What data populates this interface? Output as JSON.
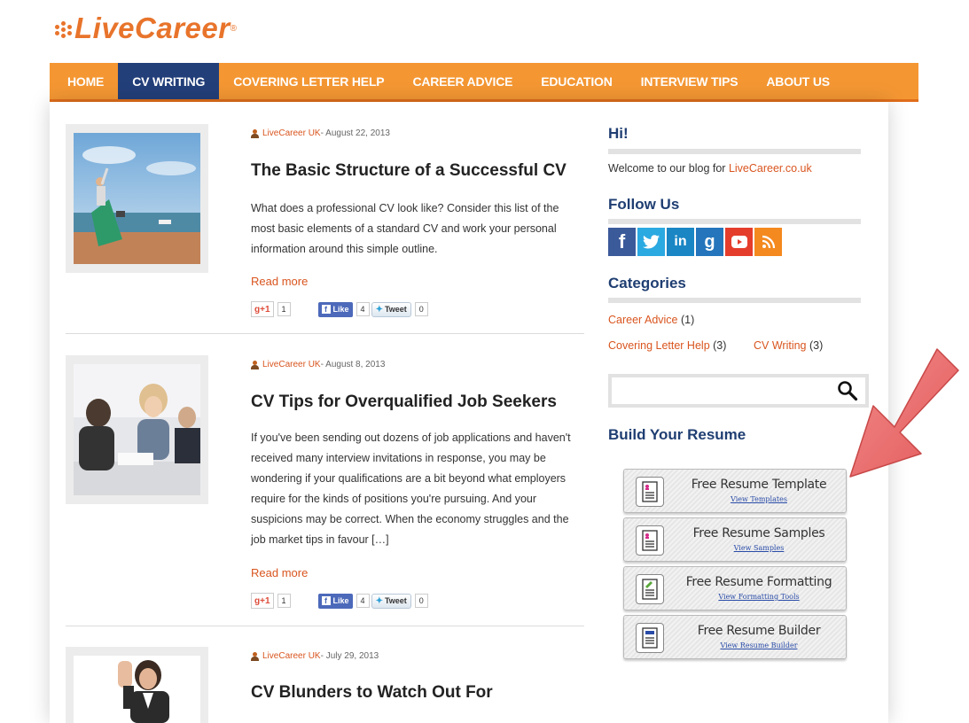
{
  "logo": {
    "text": "LiveCareer",
    "registered": "®"
  },
  "nav": {
    "items": [
      {
        "label": "HOME",
        "active": false
      },
      {
        "label": "CV WRITING",
        "active": true
      },
      {
        "label": "COVERING LETTER HELP",
        "active": false
      },
      {
        "label": "CAREER ADVICE",
        "active": false
      },
      {
        "label": "EDUCATION",
        "active": false
      },
      {
        "label": "INTERVIEW TIPS",
        "active": false
      },
      {
        "label": "ABOUT US",
        "active": false
      }
    ]
  },
  "posts": [
    {
      "author": "LiveCareer UK",
      "date": " - August 22, 2013",
      "title": "The Basic Structure of a Successful CV",
      "excerpt": "What does a professional CV look like? Consider this list of the most basic elements of a standard CV and work your personal information around this simple outline.",
      "read_more": "Read more",
      "gplus_label": "+1",
      "gplus_count": "1",
      "like_label": "Like",
      "like_count": "4",
      "tweet_label": "Tweet",
      "tweet_count": "0"
    },
    {
      "author": "LiveCareer UK",
      "date": " - August 8, 2013",
      "title": "CV Tips for Overqualified Job Seekers",
      "excerpt": "If you've been sending out dozens of job applications and haven't received many interview invitations in response, you may be wondering if your qualifications are a bit beyond what employers require for the kinds of positions you're pursuing. And your suspicions may be correct. When the economy struggles and the job market tips in favour […]",
      "read_more": "Read more",
      "gplus_label": "+1",
      "gplus_count": "1",
      "like_label": "Like",
      "like_count": "4",
      "tweet_label": "Tweet",
      "tweet_count": "0"
    },
    {
      "author": "LiveCareer UK",
      "date": " - July 29, 2013",
      "title": "CV Blunders to Watch Out For"
    }
  ],
  "sidebar": {
    "hi_heading": "Hi!",
    "welcome_text": "Welcome to our blog for ",
    "welcome_link": "LiveCareer.co.uk",
    "follow_heading": "Follow Us",
    "social_icons": [
      "facebook-icon",
      "twitter-icon",
      "linkedin-icon",
      "google-plus-icon",
      "youtube-icon",
      "rss-icon"
    ],
    "categories_heading": "Categories",
    "categories": [
      {
        "name": "Career Advice",
        "count": " (1)"
      },
      {
        "name": "Covering Letter Help",
        "count": " (3)"
      },
      {
        "name": "CV Writing",
        "count": " (3)"
      }
    ],
    "search": {
      "placeholder": ""
    },
    "build_heading": "Build Your Resume"
  },
  "resume_buttons": [
    {
      "title": "Free Resume Template",
      "link": "View Templates",
      "accent": "#d42a8a"
    },
    {
      "title": "Free Resume Samples",
      "link": "View Samples",
      "accent": "#d42a8a"
    },
    {
      "title": "Free Resume Formatting",
      "link": "View Formatting Tools",
      "accent": "#5aa83a"
    },
    {
      "title": "Free Resume Builder",
      "link": "View Resume Builder",
      "accent": "#2a4ca8"
    }
  ],
  "colors": {
    "nav_bg": "#f49733",
    "nav_active": "#233f7a",
    "link": "#d9551f",
    "heading": "#1f3e72",
    "arrow": "#ea6a6a"
  }
}
